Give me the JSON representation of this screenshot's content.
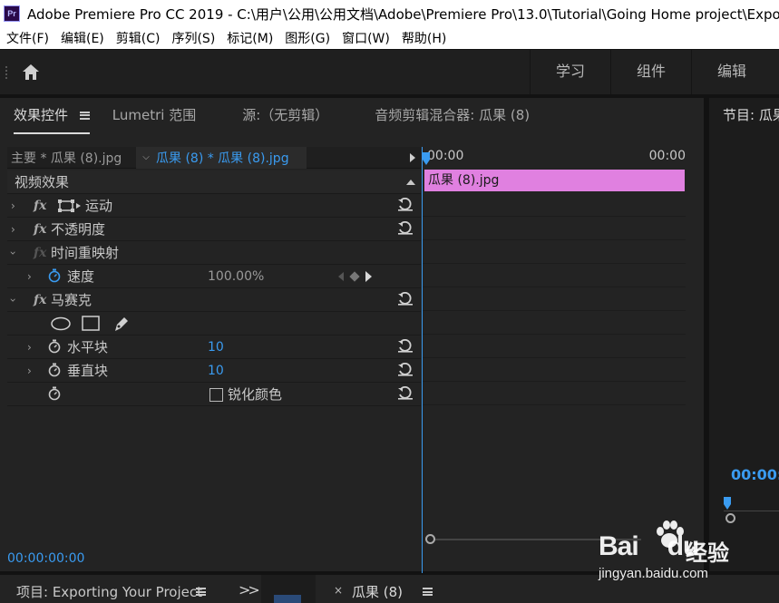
{
  "titlebar": {
    "logo": "Pr",
    "title": "Adobe Premiere Pro CC 2019 - C:\\用户\\公用\\公用文档\\Adobe\\Premiere Pro\\13.0\\Tutorial\\Going Home project\\Expo"
  },
  "menubar": {
    "items": [
      "文件(F)",
      "编辑(E)",
      "剪辑(C)",
      "序列(S)",
      "标记(M)",
      "图形(G)",
      "窗口(W)",
      "帮助(H)"
    ]
  },
  "toolbar": {
    "home_icon": "home-icon",
    "workspaces": [
      "学习",
      "组件",
      "编辑"
    ]
  },
  "effect_controls": {
    "tabs": [
      "效果控件",
      "Lumetri 范围",
      "源:（无剪辑）",
      "音频剪辑混合器: 瓜果 (8)"
    ],
    "source_master": "主要 * 瓜果 (8).jpg",
    "source_clip": "瓜果 (8) * 瓜果 (8).jpg",
    "section_header": "视频效果",
    "effects": {
      "motion": "运动",
      "opacity": "不透明度",
      "time_remap": "时间重映射",
      "speed_label": "速度",
      "speed_value": "100.00%",
      "mosaic": "马赛克",
      "h_blocks_label": "水平块",
      "h_blocks_value": "10",
      "v_blocks_label": "垂直块",
      "v_blocks_value": "10",
      "sharpen_label": "锐化颜色"
    },
    "timeline": {
      "start": "00:00",
      "end": "00:00",
      "clip_name": "瓜果 (8).jpg",
      "clip_color": "#e080e0"
    },
    "timecode": "00:00:00:00"
  },
  "program": {
    "tab": "节目: 瓜果",
    "timecode": "00:00:"
  },
  "bottom": {
    "project_tab": "项目: Exporting Your Project",
    "more": ">>",
    "sequence_close": "×",
    "sequence_tab": "瓜果 (8)"
  },
  "watermark": {
    "brand": "Bai",
    "brand2": "du",
    "cn": "经验",
    "url": "jingyan.baidu.com"
  },
  "colors": {
    "accent": "#3a9bf0",
    "panel_bg": "#232323",
    "clip": "#e080e0"
  }
}
